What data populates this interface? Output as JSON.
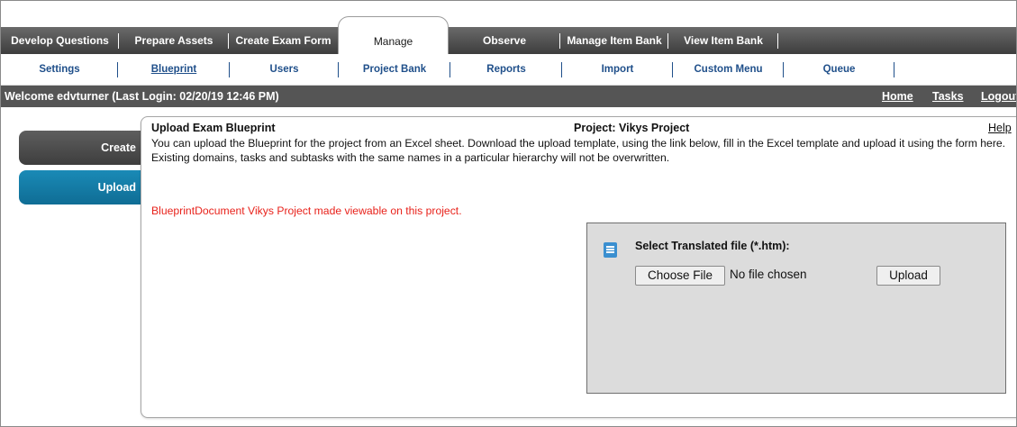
{
  "tabs": [
    {
      "label": "Develop Questions"
    },
    {
      "label": "Prepare Assets"
    },
    {
      "label": "Create Exam Form"
    },
    {
      "label": "Manage"
    },
    {
      "label": "Observe"
    },
    {
      "label": "Manage Item Bank"
    },
    {
      "label": "View Item Bank"
    }
  ],
  "subnav": [
    {
      "label": "Settings"
    },
    {
      "label": "Blueprint"
    },
    {
      "label": "Users"
    },
    {
      "label": "Project Bank"
    },
    {
      "label": "Reports"
    },
    {
      "label": "Import"
    },
    {
      "label": "Custom Menu"
    },
    {
      "label": "Queue"
    }
  ],
  "welcome": {
    "text": "Welcome edvturner (Last Login: 02/20/19   12:46 PM)",
    "home": "Home",
    "tasks": "Tasks",
    "logout": "Logout"
  },
  "sidebar": {
    "create": "Create",
    "upload": "Upload"
  },
  "panel": {
    "title": "Upload Exam Blueprint",
    "project": "Project: Vikys Project",
    "help": "Help",
    "description": "You can upload the Blueprint for the project from an Excel sheet. Download the upload template, using the link below, fill in the Excel template and upload it using the form here. Existing domains, tasks and subtasks with the same names in a particular hierarchy will not be overwritten.",
    "message": "BlueprintDocument Vikys Project made viewable on this project."
  },
  "upload_form": {
    "label": "Select Translated file (*.htm):",
    "choose_button": "Choose File",
    "no_file": "No file chosen",
    "upload_button": "Upload",
    "icon": "document-icon"
  },
  "colors": {
    "accent": "#0f6d95",
    "error": "#e8221b",
    "nav_text": "#1f4f8a"
  }
}
